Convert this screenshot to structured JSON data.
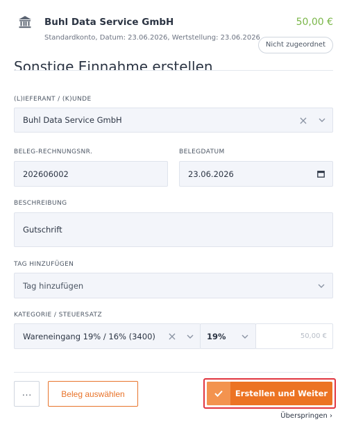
{
  "transaction": {
    "name": "Buhl Data Service GmbH",
    "meta": "Standardkonto, Datum: 23.06.2026, Wertstellung: 23.06.2026",
    "amount": "50,00 €",
    "status": "Nicht zugeordnet",
    "amount_color": "#7ab648"
  },
  "form": {
    "title": "Sonstige Einnahme erstellen",
    "supplier": {
      "label": "(L)ieferant / (K)unde",
      "value": "Buhl Data Service GmbH"
    },
    "invoice_no": {
      "label": "Beleg-Rechnungsnr.",
      "value": "202606002"
    },
    "date": {
      "label": "Belegdatum",
      "value": "23.06.2026"
    },
    "description": {
      "label": "Beschreibung",
      "value": "Gutschrift"
    },
    "tag": {
      "label": "Tag hinzufügen",
      "placeholder": "Tag hinzufügen"
    },
    "category": {
      "label": "Kategorie / Steuersatz",
      "value": "Wareneingang 19% / 16% (3400)",
      "tax_rate": "19%",
      "amount_placeholder": "50,00 €"
    }
  },
  "actions": {
    "more": "···",
    "select_receipt": "Beleg auswählen",
    "create_next": "Erstellen und Weiter",
    "skip": "Überspringen ›"
  },
  "colors": {
    "accent": "#ec7323",
    "highlight_border": "#e1343e"
  },
  "icons": [
    "bank-icon",
    "clear-icon",
    "chevron-down-icon",
    "calendar-icon",
    "check-icon"
  ]
}
